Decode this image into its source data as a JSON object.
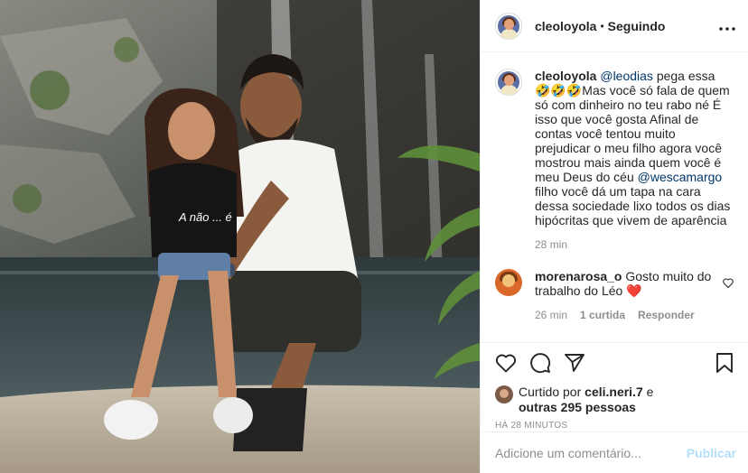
{
  "post": {
    "username": "cleoloyola",
    "separator": "•",
    "follow_status": "Seguindo",
    "more_icon": "ellipsis-icon"
  },
  "caption": {
    "username": "cleoloyola",
    "mention1": "@leodias",
    "text1": " pega essa 🤣🤣🤣Mas você só fala de quem só com dinheiro no teu rabo né É isso que você gosta Afinal de contas você tentou muito prejudicar o meu filho agora você mostrou mais ainda quem você é meu Deus do céu ",
    "mention2": "@wescamargo",
    "text2": " filho você dá um tapa na cara dessa sociedade lixo todos os dias hipócritas que vivem de aparência",
    "time": "28 min"
  },
  "comment": {
    "username": "morenarosa_o",
    "text": " Gosto muito do trabalho do Léo ",
    "heart": "❤️",
    "time": "26 min",
    "likes": "1 curtida",
    "reply": "Responder"
  },
  "likes": {
    "prefix": "Curtido por ",
    "user": "celi.neri.7",
    "mid": " e",
    "others": "outras 295 pessoas"
  },
  "timestamp": "HÁ 28 MINUTOS",
  "add_comment": {
    "placeholder": "Adicione um comentário...",
    "publish": "Publicar"
  },
  "photo": {
    "shirt_text": "A não ... é"
  },
  "colors": {
    "link": "#00376b",
    "muted": "#8e8e8e",
    "publish_disabled": "#b2dffc",
    "heart": "#ed4956"
  }
}
